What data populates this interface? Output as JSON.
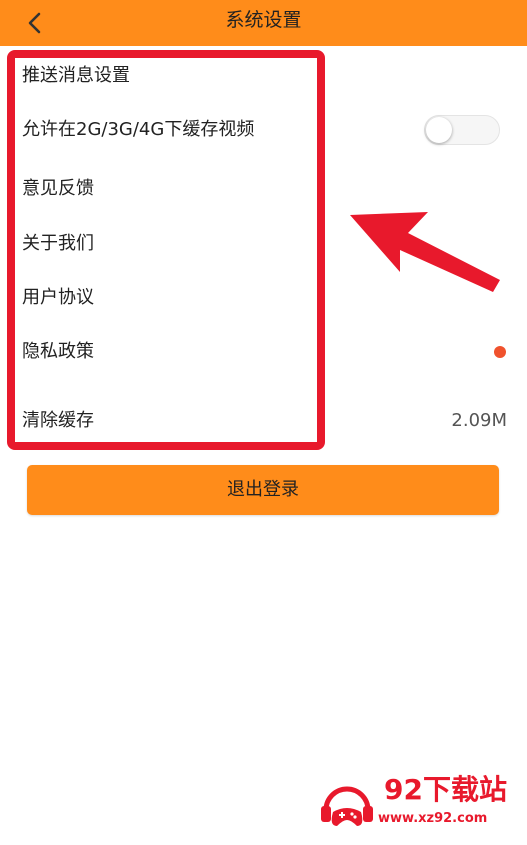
{
  "header": {
    "title": "系统设置",
    "back_icon": "chevron-left-icon",
    "background_color": "#ff8c1a"
  },
  "settings": {
    "push": {
      "label": "推送消息设置"
    },
    "cache_video": {
      "label": "允许在2G/3G/4G下缓存视频",
      "toggle_on": false
    },
    "feedback": {
      "label": "意见反馈"
    },
    "about": {
      "label": "关于我们"
    },
    "agreement": {
      "label": "用户协议"
    },
    "privacy": {
      "label": "隐私政策",
      "badge": "red-dot"
    },
    "clear_cache": {
      "label": "清除缓存",
      "value": "2.09M"
    }
  },
  "logout": {
    "label": "退出登录",
    "color": "#ff8c1a"
  },
  "annotation": {
    "box_color": "#e8192c",
    "arrow_icon": "arrow-pointer-icon"
  },
  "watermark": {
    "title": "92下载站",
    "url": "www.xz92.com",
    "logo_icon": "gamepad-headphones-logo-icon",
    "color": "#e8192c"
  }
}
